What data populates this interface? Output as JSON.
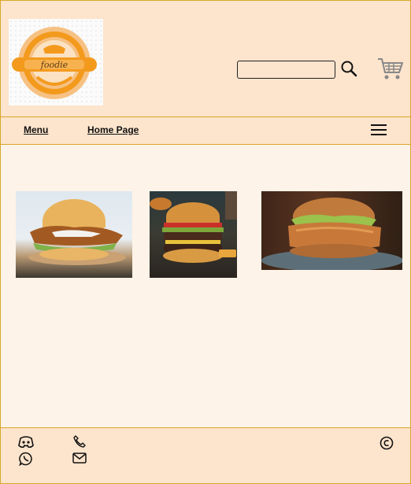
{
  "header": {
    "logo_text": "foodie",
    "search": {
      "value": "",
      "placeholder": ""
    },
    "icons": {
      "search": "search-icon",
      "cart": "cart-icon"
    }
  },
  "nav": {
    "menu_label": "Menu",
    "home_label": "Home Page ",
    "hamburger_icon": "hamburger-menu-icon"
  },
  "gallery": {
    "images": [
      {
        "subject": "crispy chicken burger with lettuce and sauce"
      },
      {
        "subject": "beef cheeseburger with tomato and pickles"
      },
      {
        "subject": "fried chicken burger with lettuce on a plate"
      }
    ]
  },
  "footer": {
    "icons": [
      "discord-icon",
      "phone-icon",
      "whatsapp-icon",
      "mail-icon",
      "copyright-icon"
    ]
  },
  "colors": {
    "header_bg": "#fde4cc",
    "page_bg": "#fdf3e8",
    "border": "#d9a62a",
    "logo_orange": "#f39a1d"
  }
}
